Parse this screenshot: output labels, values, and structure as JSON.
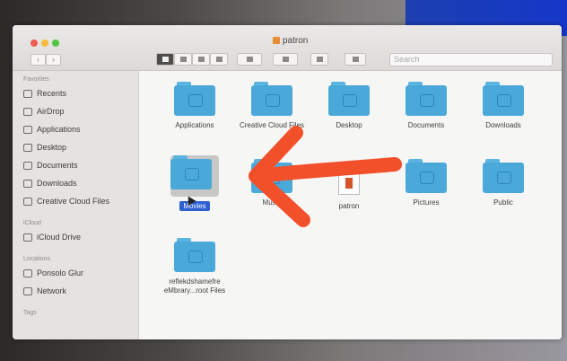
{
  "window": {
    "title": "patron"
  },
  "toolbar": {
    "back": "‹",
    "forward": "›",
    "search_placeholder": "Search"
  },
  "sidebar": {
    "favorites_header": "Favorites",
    "favorites": [
      {
        "label": "Recents",
        "icon": "clock-icon"
      },
      {
        "label": "AirDrop",
        "icon": "airdrop-icon"
      },
      {
        "label": "Applications",
        "icon": "applications-icon"
      },
      {
        "label": "Desktop",
        "icon": "desktop-icon"
      },
      {
        "label": "Documents",
        "icon": "document-icon"
      },
      {
        "label": "Downloads",
        "icon": "download-icon"
      },
      {
        "label": "Creative Cloud Files",
        "icon": "folder-icon"
      }
    ],
    "icloud_header": "iCloud",
    "icloud": [
      {
        "label": "iCloud Drive",
        "icon": "cloud-icon"
      }
    ],
    "locations_header": "Locations",
    "locations": [
      {
        "label": "Ponsolo Glur",
        "icon": "disk-icon"
      },
      {
        "label": "Network",
        "icon": "network-icon"
      }
    ],
    "tags_header": "Tags"
  },
  "items": [
    {
      "label": "Applications"
    },
    {
      "label": "Creative Cloud Files"
    },
    {
      "label": "Desktop"
    },
    {
      "label": "Documents"
    },
    {
      "label": "Downloads"
    },
    {
      "label": "Movies"
    },
    {
      "label": "Music"
    },
    {
      "label": "patron"
    },
    {
      "label": "Pictures"
    },
    {
      "label": "Public"
    },
    {
      "label": "reflekdshamefre eMbrary...root Files"
    }
  ],
  "annotation": {
    "color": "#f2502b"
  }
}
